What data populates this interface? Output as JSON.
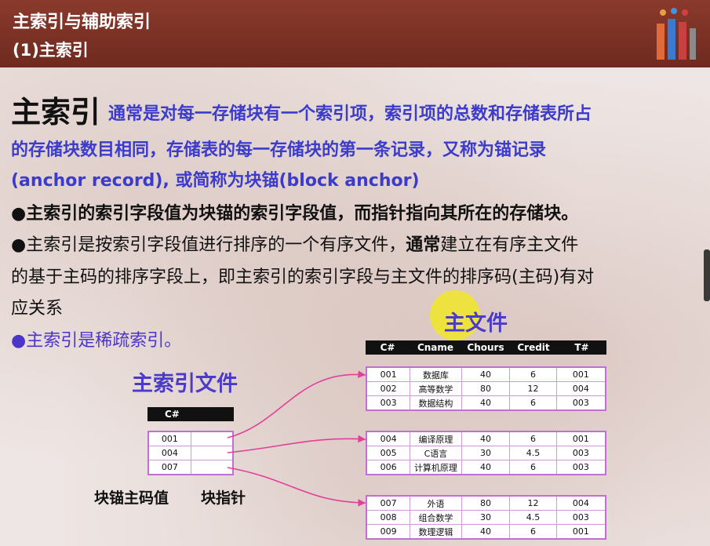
{
  "header": {
    "title": "主索引与辅助索引",
    "subtitle": "(1)主索引"
  },
  "intro": {
    "term": "主索引",
    "line1": "通常是对每一存储块有一个索引项，索引项的总数和存储表所占",
    "line2": "的存储块数目相同，存储表的每一存储块的第一条记录，又称为锚记录",
    "line3": "(anchor record), 或简称为块锚(block anchor)"
  },
  "bullets": {
    "b1": "●主索引的索引字段值为块锚的索引字段值，而指针指向其所在的存储块。",
    "b2_line1_a": "●主索引是按索引字段值进行排序的一个有序文件，",
    "b2_line1_b": "通常",
    "b2_line1_c": "建立在有序主文件",
    "b2_line2": "的基于主码的排序字段上，即主索引的索引字段与主文件的排序码(主码)有对",
    "b2_line3": "应关系",
    "b3": "●主索引是稀疏索引。"
  },
  "main_file": {
    "title": "主文件",
    "headers": [
      "C#",
      "Cname",
      "Chours",
      "Credit",
      "T#"
    ],
    "blocks": [
      [
        [
          "001",
          "数据库",
          "40",
          "6",
          "001"
        ],
        [
          "002",
          "高等数学",
          "80",
          "12",
          "004"
        ],
        [
          "003",
          "数据结构",
          "40",
          "6",
          "003"
        ]
      ],
      [
        [
          "004",
          "编译原理",
          "40",
          "6",
          "001"
        ],
        [
          "005",
          "C语言",
          "30",
          "4.5",
          "003"
        ],
        [
          "006",
          "计算机原理",
          "40",
          "6",
          "003"
        ]
      ],
      [
        [
          "007",
          "外语",
          "80",
          "12",
          "004"
        ],
        [
          "008",
          "组合数学",
          "30",
          "4.5",
          "003"
        ],
        [
          "009",
          "数理逻辑",
          "40",
          "6",
          "001"
        ]
      ]
    ]
  },
  "primary_index": {
    "title": "主索引文件",
    "header": "C#",
    "keys": [
      "001",
      "004",
      "007"
    ],
    "label_key": "块锚主码值",
    "label_ptr": "块指针"
  },
  "colors": {
    "title_bar": "#7a3024",
    "blue_text": "#3b3bcc",
    "highlight": "#f0e628",
    "table_border": "#c070d0",
    "arrow": "#e0409a"
  }
}
